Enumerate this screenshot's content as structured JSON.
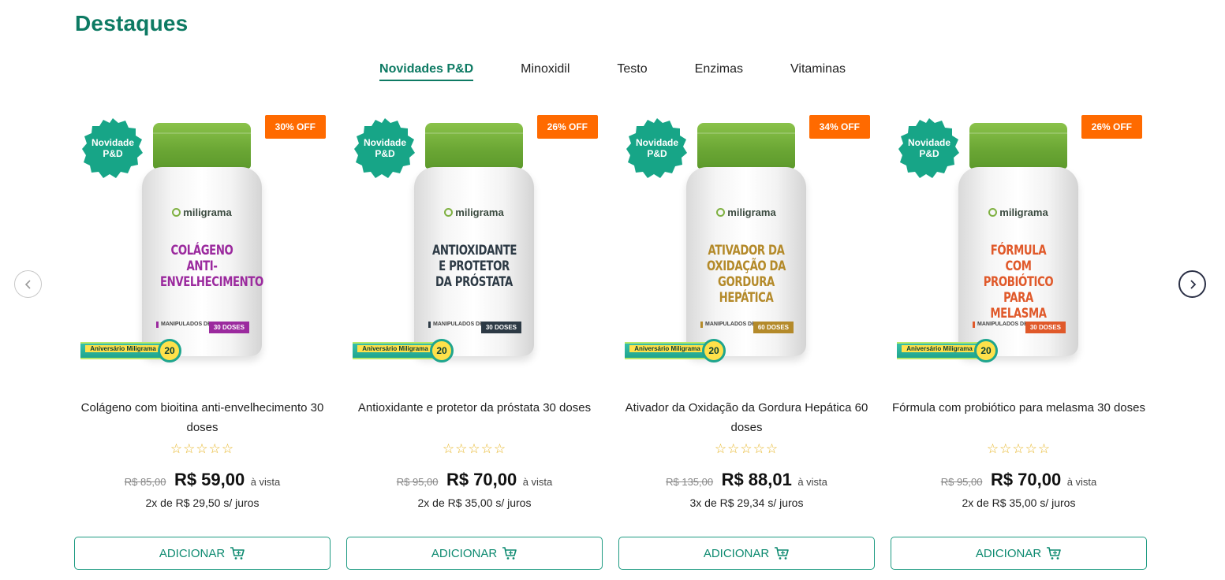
{
  "section": {
    "title": "Destaques"
  },
  "tabs": [
    {
      "label": "Novidades P&D",
      "active": true
    },
    {
      "label": "Minoxidil",
      "active": false
    },
    {
      "label": "Testo",
      "active": false
    },
    {
      "label": "Enzimas",
      "active": false
    },
    {
      "label": "Vitaminas",
      "active": false
    }
  ],
  "carousel": {
    "prev_icon": "chevron-left-icon",
    "next_icon": "chevron-right-icon"
  },
  "products": [
    {
      "name": "Colágeno com bioitina anti-envelhecimento 30 doses",
      "badge_novidade": "Novidade P&D",
      "discount": "30% OFF",
      "label_text": "Colágeno Anti-Envelhecimento",
      "label_color": "#9b2a9e",
      "doses_label": "30 DOSES",
      "brand": "miligrama",
      "quality_label": "MANIPULADOS DE QUALIDADE",
      "anniversary": "Aniversário Miligrama",
      "anniversary_number": "20",
      "rating": "☆☆☆☆☆",
      "old_price": "R$ 85,00",
      "price": "R$ 59,00",
      "cash_note": "à vista",
      "installments": "2x de R$ 29,50 s/ juros",
      "button_label": "ADICIONAR"
    },
    {
      "name": "Antioxidante e protetor da próstata 30 doses",
      "badge_novidade": "Novidade P&D",
      "discount": "26% OFF",
      "label_text": "Antioxidante e Protetor da Próstata",
      "label_color": "#2d3a45",
      "doses_label": "30 DOSES",
      "brand": "miligrama",
      "quality_label": "MANIPULADOS DE QUALIDADE",
      "anniversary": "Aniversário Miligrama",
      "anniversary_number": "20",
      "rating": "☆☆☆☆☆",
      "old_price": "R$ 95,00",
      "price": "R$ 70,00",
      "cash_note": "à vista",
      "installments": "2x de R$ 35,00 s/ juros",
      "button_label": "ADICIONAR"
    },
    {
      "name": "Ativador da Oxidação da Gordura Hepática 60 doses",
      "badge_novidade": "Novidade P&D",
      "discount": "34% OFF",
      "label_text": "Ativador da Oxidação da Gordura Hepática",
      "label_color": "#b48a2a",
      "doses_label": "60 DOSES",
      "brand": "miligrama",
      "quality_label": "MANIPULADOS DE QUALIDADE",
      "anniversary": "Aniversário Miligrama",
      "anniversary_number": "20",
      "rating": "☆☆☆☆☆",
      "old_price": "R$ 135,00",
      "price": "R$ 88,01",
      "cash_note": "à vista",
      "installments": "3x de R$ 29,34 s/ juros",
      "button_label": "ADICIONAR"
    },
    {
      "name": "Fórmula com probiótico para melasma 30 doses",
      "badge_novidade": "Novidade P&D",
      "discount": "26% OFF",
      "label_text": "Fórmula com Probiótico para Melasma",
      "label_color": "#e0592a",
      "doses_label": "30 DOSES",
      "brand": "miligrama",
      "quality_label": "MANIPULADOS DE QUALIDADE",
      "anniversary": "Aniversário Miligrama",
      "anniversary_number": "20",
      "rating": "☆☆☆☆☆",
      "old_price": "R$ 95,00",
      "price": "R$ 70,00",
      "cash_note": "à vista",
      "installments": "2x de R$ 35,00 s/ juros",
      "button_label": "ADICIONAR"
    }
  ],
  "colors": {
    "brand_green": "#0d7a63",
    "button_border": "#1e9b82",
    "discount_badge": "#ff6a00",
    "novidade_badge": "#17a587",
    "star_color": "#e6b422"
  }
}
